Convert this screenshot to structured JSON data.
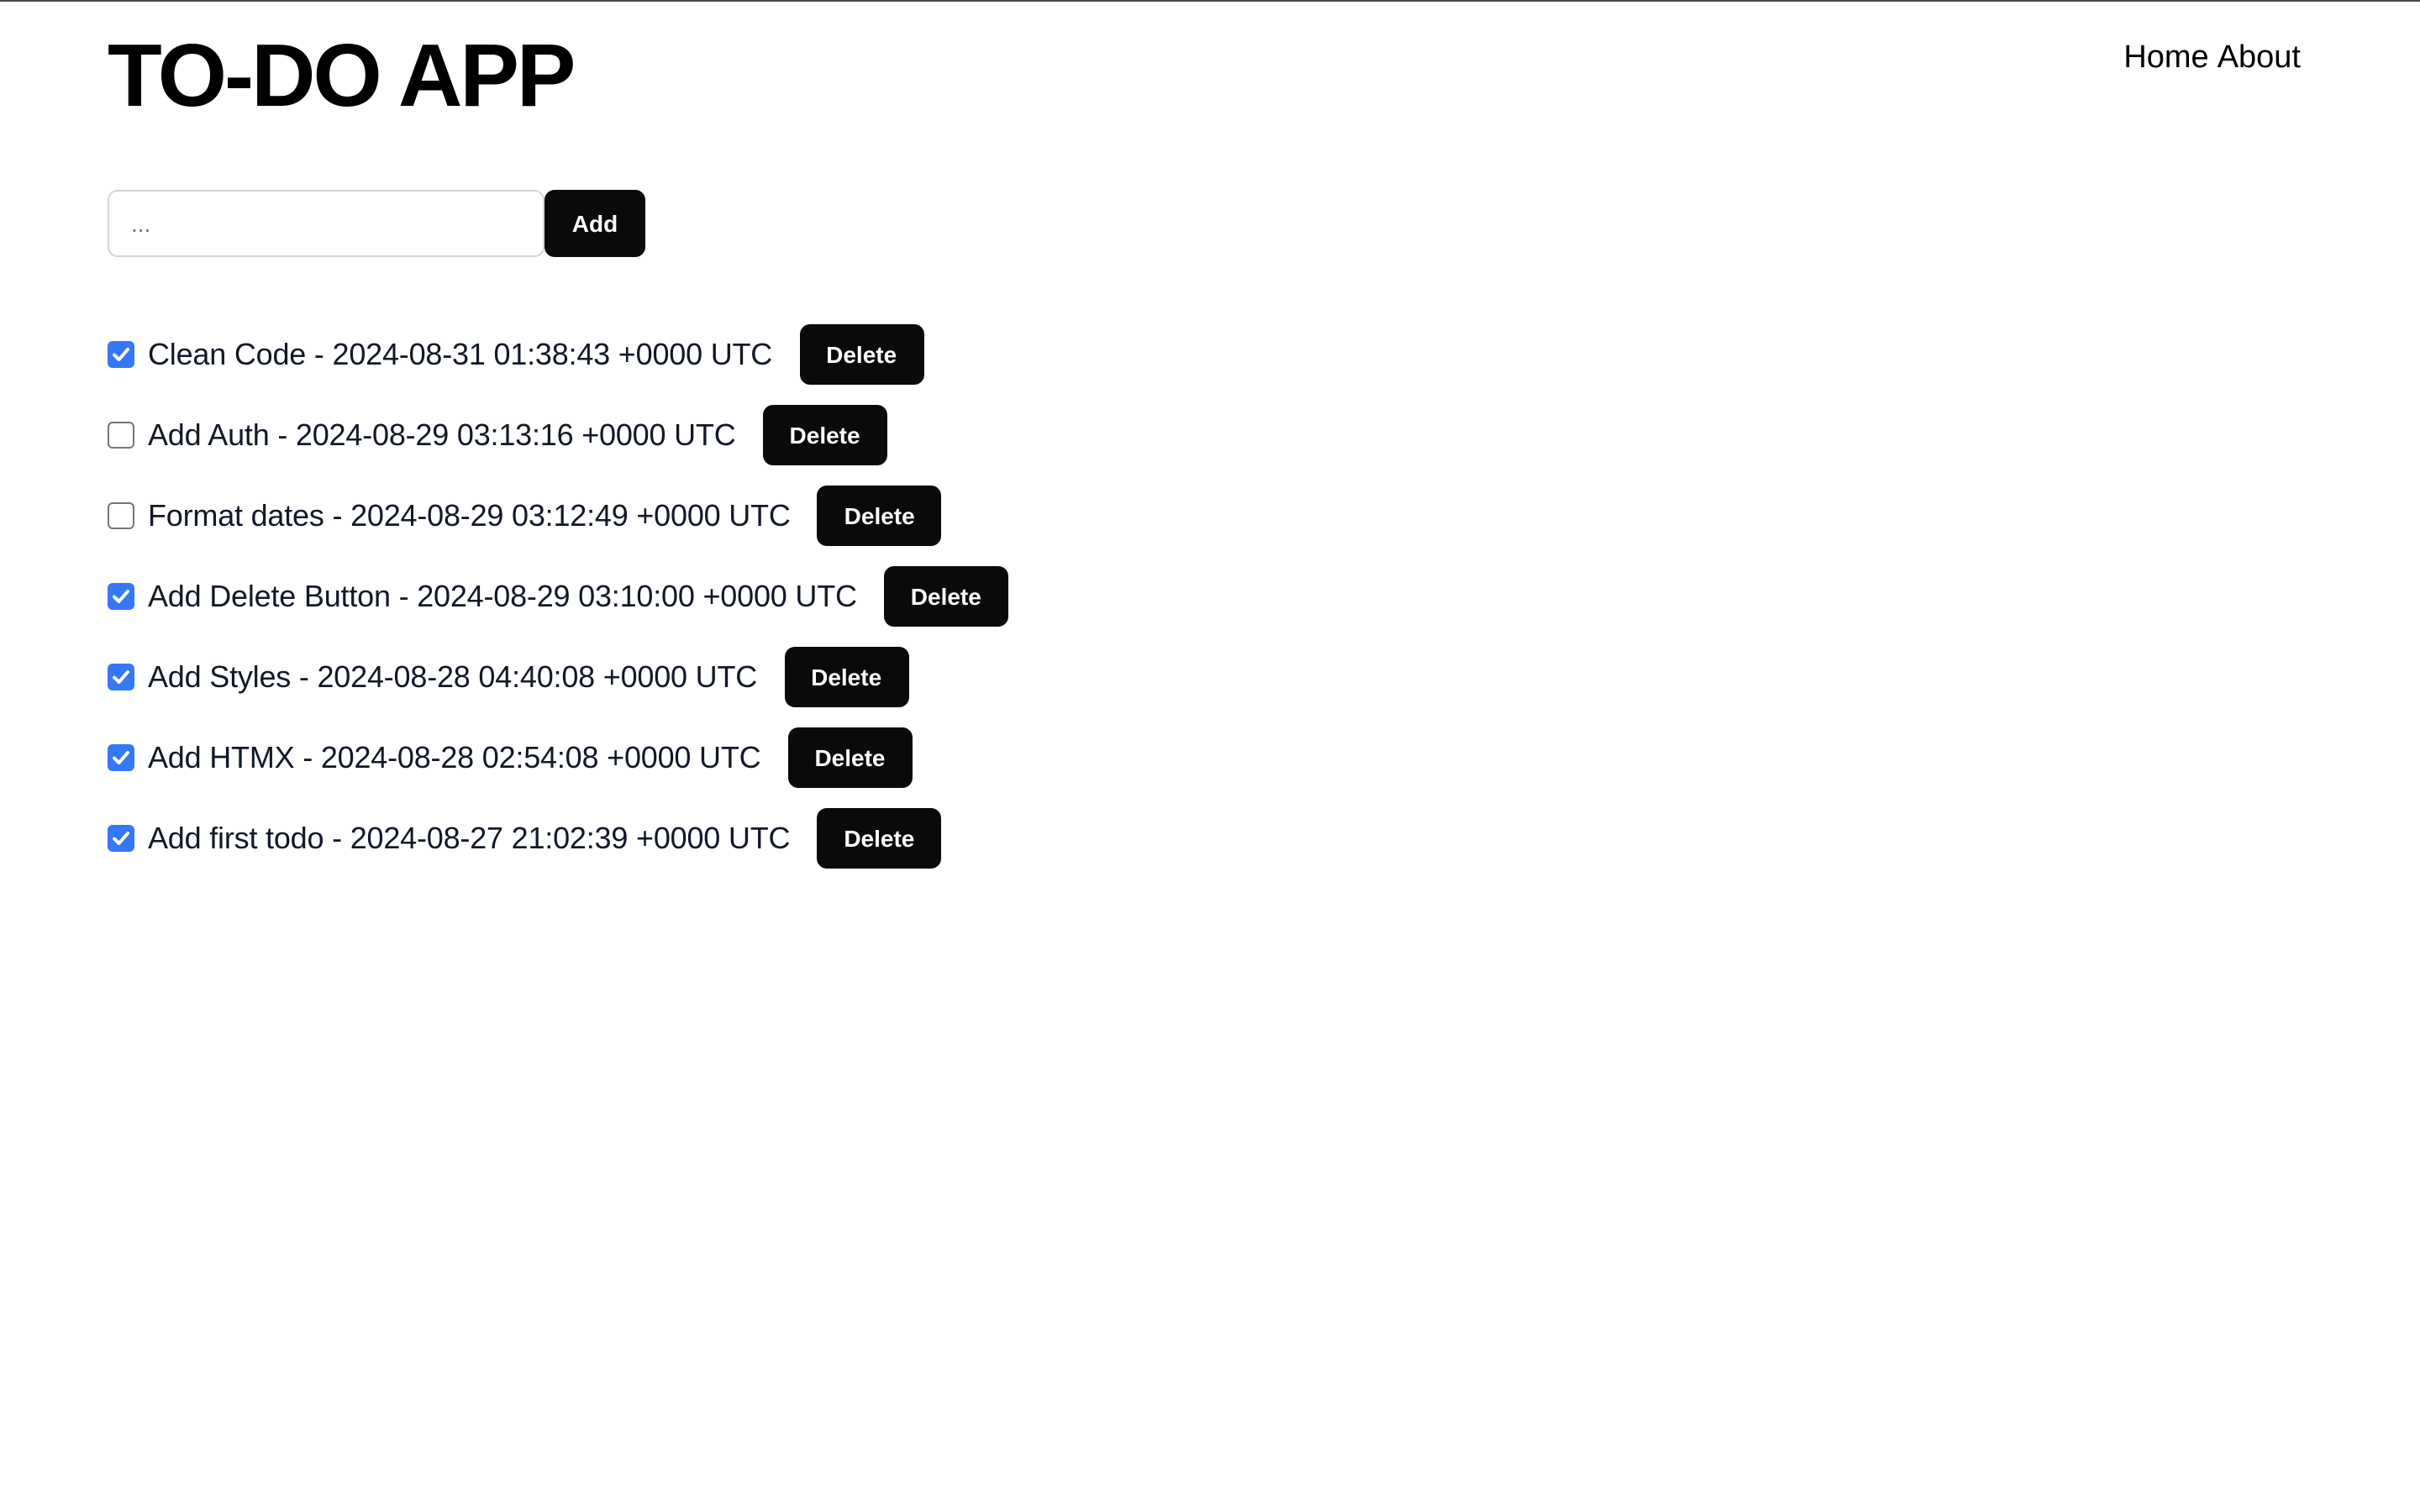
{
  "header": {
    "title": "TO-DO APP",
    "nav": [
      {
        "label": "Home"
      },
      {
        "label": "About"
      }
    ]
  },
  "add_form": {
    "input_value": "",
    "input_placeholder": "...",
    "add_label": "Add"
  },
  "colors": {
    "checkbox_checked": "#3478f6",
    "button_bg": "#0a0a0a",
    "text": "#111827"
  },
  "todos": [
    {
      "text": "Clean Code - 2024-08-31 01:38:43 +0000 UTC",
      "checked": true,
      "delete_label": "Delete"
    },
    {
      "text": "Add Auth - 2024-08-29 03:13:16 +0000 UTC",
      "checked": false,
      "delete_label": "Delete"
    },
    {
      "text": "Format dates - 2024-08-29 03:12:49 +0000 UTC",
      "checked": false,
      "delete_label": "Delete"
    },
    {
      "text": "Add Delete Button - 2024-08-29 03:10:00 +0000 UTC",
      "checked": true,
      "delete_label": "Delete"
    },
    {
      "text": "Add Styles - 2024-08-28 04:40:08 +0000 UTC",
      "checked": true,
      "delete_label": "Delete"
    },
    {
      "text": "Add HTMX - 2024-08-28 02:54:08 +0000 UTC",
      "checked": true,
      "delete_label": "Delete"
    },
    {
      "text": "Add first todo - 2024-08-27 21:02:39 +0000 UTC",
      "checked": true,
      "delete_label": "Delete"
    }
  ]
}
